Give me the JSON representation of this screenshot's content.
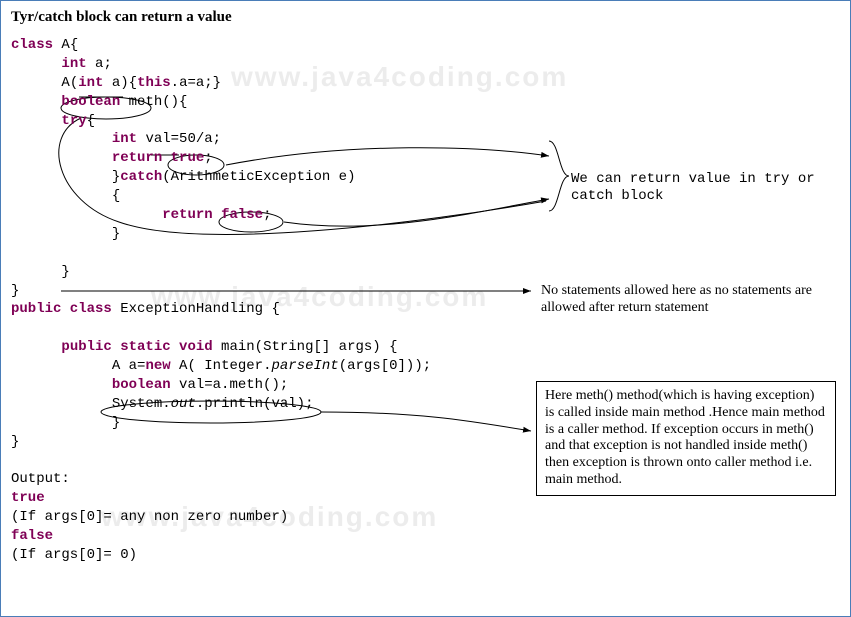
{
  "title": "Tyr/catch block can return a value",
  "watermark": "www.java4coding.com",
  "code": {
    "line1_kw": "class",
    "line1_rest": " A{",
    "line2_kw": "int",
    "line2_rest": " a;",
    "line3_a": "A(",
    "line3_kw": "int",
    "line3_b": " a){",
    "line3_kw2": "this",
    "line3_c": ".a=a;}",
    "line4_kw": "boolean",
    "line4_rest": " meth(){",
    "line5_kw": "try",
    "line5_rest": "{",
    "line6_kw": "int",
    "line6_rest": " val=50/a;",
    "line7_kw": "return",
    "line7_sp": " ",
    "line7_kw2": "true",
    "line7_rest": ";",
    "line8_a": "}",
    "line8_kw": "catch",
    "line8_b": "(ArithmeticException e)",
    "line9": "{",
    "line10_kw": "return",
    "line10_sp": " ",
    "line10_kw2": "false",
    "line10_rest": ";",
    "line11": "}",
    "line12": "",
    "line13": "}",
    "line14": "}",
    "line15_kw": "public class",
    "line15_rest": " ExceptionHandling {",
    "line16": "",
    "line17_kw": "public static void",
    "line17_rest": " main(String[] args) {",
    "line18_a": "A a=",
    "line18_kw": "new",
    "line18_b": " A( Integer.",
    "line18_it": "parseInt",
    "line18_c": "(args[0]));",
    "line19_kw": "boolean",
    "line19_rest": " val=a.meth();",
    "line20_a": "System.",
    "line20_it": "out",
    "line20_b": ".println(val);",
    "line21": "}",
    "line22": "}",
    "line23": "",
    "out_label": "Output:",
    "out_true": "true",
    "out_true_cond": "(If args[0]= any non zero number)",
    "out_false": "false",
    "out_false_cond": "(If args[0]= 0)"
  },
  "annotations": {
    "a1": "We can return value in try or catch block",
    "a2": "No statements allowed here as no statements are allowed after return statement",
    "a3": "Here meth() method(which is having exception) is called inside main method .Hence main method is a caller method. If exception occurs in meth() and that exception is not handled  inside meth() then exception is thrown onto caller method i.e. main method."
  }
}
